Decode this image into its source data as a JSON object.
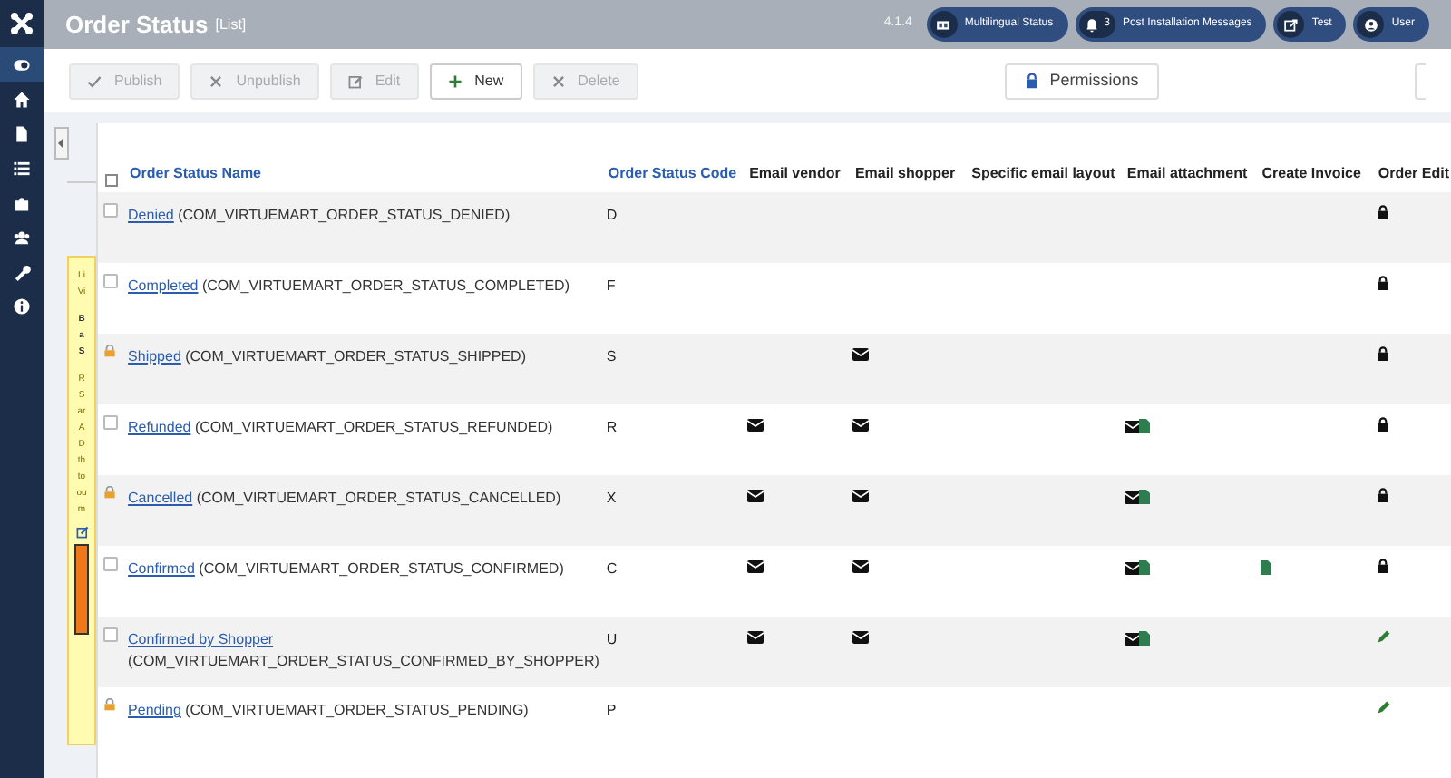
{
  "header": {
    "title": "Order Status",
    "subtitle": "[List]",
    "version": "4.1.4",
    "buttons": [
      {
        "kind": "multilingual",
        "label": "Multilingual Status"
      },
      {
        "kind": "bell",
        "count": "3",
        "label": "Post Installation Messages"
      },
      {
        "kind": "external",
        "label": "Test"
      },
      {
        "kind": "user",
        "label": "User"
      }
    ]
  },
  "sidebar": {
    "items": [
      {
        "kind": "toggle",
        "selected": true
      },
      {
        "kind": "home",
        "selected": false
      },
      {
        "kind": "file",
        "selected": false
      },
      {
        "kind": "list",
        "selected": false
      },
      {
        "kind": "puzzle",
        "selected": false
      },
      {
        "kind": "users",
        "selected": false
      },
      {
        "kind": "wrench",
        "selected": false
      },
      {
        "kind": "info",
        "selected": false
      }
    ]
  },
  "toolbar": {
    "buttons": [
      {
        "kind": "check",
        "label": "Publish",
        "disabled": true
      },
      {
        "kind": "times",
        "label": "Unpublish",
        "disabled": true
      },
      {
        "kind": "edit",
        "label": "Edit",
        "disabled": true
      },
      {
        "kind": "plus",
        "label": "New",
        "disabled": false
      },
      {
        "kind": "times",
        "label": "Delete",
        "disabled": true
      }
    ],
    "permissions": "Permissions"
  },
  "side_panel": {
    "lines": [
      "Li",
      "Vi",
      "B",
      "a",
      "S",
      "R",
      "S",
      "ar",
      "A",
      "D",
      "th",
      "to",
      "ou",
      "m"
    ]
  },
  "table": {
    "select_all_checked": false,
    "columns": [
      "Order Status Name",
      "Order Status Code",
      "Email vendor",
      "Email shopper",
      "Specific email layout",
      "Email attachment",
      "Create Invoice",
      "Order Edit"
    ],
    "rows": [
      {
        "name": "Denied",
        "constant": "(COM_VIRTUEMART_ORDER_STATUS_DENIED)",
        "code": "D",
        "locked": false,
        "email_vendor": false,
        "email_shopper": false,
        "email_attachment": false,
        "create_invoice": false,
        "order_edit_locked": true
      },
      {
        "name": "Completed",
        "constant": "(COM_VIRTUEMART_ORDER_STATUS_COMPLETED)",
        "code": "F",
        "locked": false,
        "email_vendor": false,
        "email_shopper": false,
        "email_attachment": false,
        "create_invoice": false,
        "order_edit_locked": true
      },
      {
        "name": "Shipped",
        "constant": "(COM_VIRTUEMART_ORDER_STATUS_SHIPPED)",
        "code": "S",
        "locked": true,
        "email_vendor": false,
        "email_shopper": true,
        "email_attachment": false,
        "create_invoice": false,
        "order_edit_locked": true
      },
      {
        "name": "Refunded",
        "constant": "(COM_VIRTUEMART_ORDER_STATUS_REFUNDED)",
        "code": "R",
        "locked": false,
        "email_vendor": true,
        "email_shopper": true,
        "email_attachment": true,
        "create_invoice": false,
        "order_edit_locked": true
      },
      {
        "name": "Cancelled",
        "constant": "(COM_VIRTUEMART_ORDER_STATUS_CANCELLED)",
        "code": "X",
        "locked": true,
        "email_vendor": true,
        "email_shopper": true,
        "email_attachment": true,
        "create_invoice": false,
        "order_edit_locked": true
      },
      {
        "name": "Confirmed",
        "constant": "(COM_VIRTUEMART_ORDER_STATUS_CONFIRMED)",
        "code": "C",
        "locked": false,
        "email_vendor": true,
        "email_shopper": true,
        "email_attachment": true,
        "create_invoice": true,
        "order_edit_locked": true
      },
      {
        "name": "Confirmed by Shopper",
        "constant": "(COM_VIRTUEMART_ORDER_STATUS_CONFIRMED_BY_SHOPPER)",
        "code": "U",
        "locked": false,
        "email_vendor": true,
        "email_shopper": true,
        "email_attachment": true,
        "create_invoice": false,
        "order_edit_locked": false
      },
      {
        "name": "Pending",
        "constant": "(COM_VIRTUEMART_ORDER_STATUS_PENDING)",
        "code": "P",
        "locked": true,
        "email_vendor": false,
        "email_shopper": false,
        "email_attachment": false,
        "create_invoice": false,
        "order_edit_locked": false
      }
    ]
  }
}
